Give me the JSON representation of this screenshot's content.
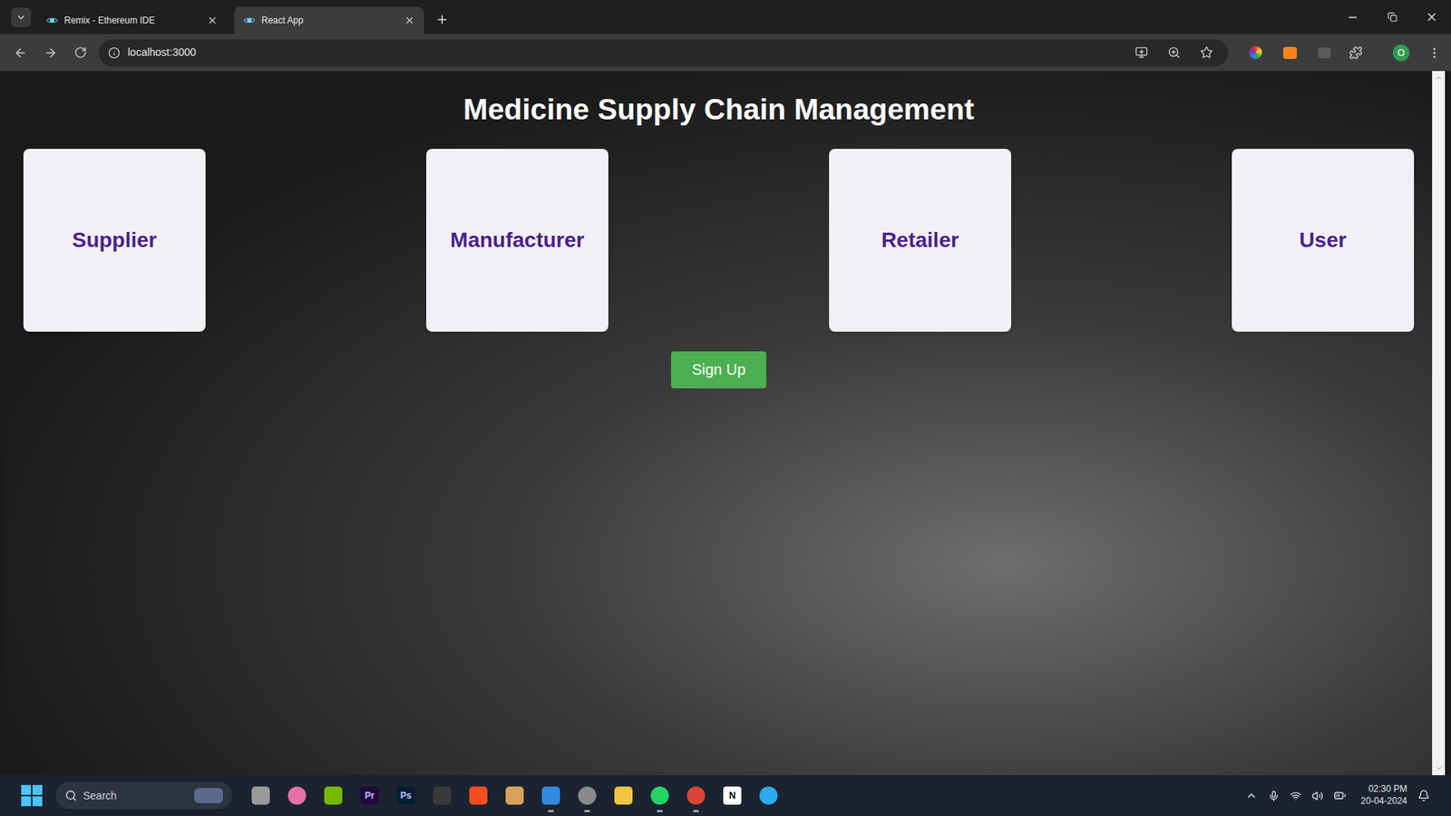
{
  "browser": {
    "tabs": [
      {
        "label": "Remix - Ethereum IDE",
        "selected": false
      },
      {
        "label": "React App",
        "selected": true
      }
    ],
    "address": "localhost:3000",
    "profile_initial": "O"
  },
  "page": {
    "title": "Medicine Supply Chain Management",
    "roles": [
      "Supplier",
      "Manufacturer",
      "Retailer",
      "User"
    ],
    "signup_button": "Sign Up"
  },
  "taskbar": {
    "search_placeholder": "Search",
    "apps": [
      {
        "kind": "shape",
        "label": "",
        "color": "#9a9a9a",
        "running": false
      },
      {
        "kind": "round",
        "label": "",
        "color": "#e86fa8",
        "running": false
      },
      {
        "kind": "shape",
        "label": "",
        "color": "#76b900",
        "running": false
      },
      {
        "kind": "glyph",
        "label": "Pr",
        "color": "#1f0a3c",
        "running": false
      },
      {
        "kind": "glyph",
        "label": "Ps",
        "color": "#001e36",
        "running": false
      },
      {
        "kind": "shape",
        "label": "",
        "color": "#3a3a3a",
        "running": false
      },
      {
        "kind": "shape",
        "label": "",
        "color": "#f24e1e",
        "running": false
      },
      {
        "kind": "shape",
        "label": "",
        "color": "#d9a25a",
        "running": false
      },
      {
        "kind": "shape",
        "label": "",
        "color": "#2f8ae0",
        "running": true
      },
      {
        "kind": "round",
        "label": "",
        "color": "#8a8a8a",
        "running": true
      },
      {
        "kind": "shape",
        "label": "",
        "color": "#f5c342",
        "running": false
      },
      {
        "kind": "round",
        "label": "",
        "color": "#25d366",
        "running": true
      },
      {
        "kind": "round",
        "label": "",
        "color": "#db4437",
        "running": true
      },
      {
        "kind": "glyph",
        "label": "N",
        "color": "#ffffff",
        "running": false
      },
      {
        "kind": "round",
        "label": "",
        "color": "#2aabee",
        "running": false
      }
    ],
    "time": "02:30 PM",
    "date": "20-04-2024"
  }
}
